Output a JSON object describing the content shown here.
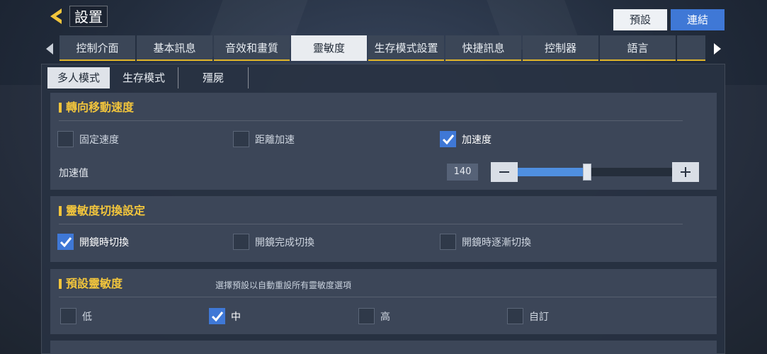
{
  "header": {
    "title": "設置",
    "preset_label": "預設",
    "link_label": "連結"
  },
  "tabs": [
    {
      "label": "控制介面",
      "active": false
    },
    {
      "label": "基本訊息",
      "active": false
    },
    {
      "label": "音效和畫質",
      "active": false
    },
    {
      "label": "靈敏度",
      "active": true
    },
    {
      "label": "生存模式設置",
      "active": false
    },
    {
      "label": "快捷訊息",
      "active": false
    },
    {
      "label": "控制器",
      "active": false
    },
    {
      "label": "語言",
      "active": false
    }
  ],
  "subtabs": [
    {
      "label": "多人模式",
      "active": true
    },
    {
      "label": "生存模式",
      "active": false
    },
    {
      "label": "殭屍",
      "active": false
    }
  ],
  "turn_speed": {
    "title": "轉向移動速度",
    "options": [
      {
        "label": "固定速度",
        "checked": false
      },
      {
        "label": "距離加速",
        "checked": false
      },
      {
        "label": "加速度",
        "checked": true
      }
    ],
    "accel_label": "加速值",
    "accel_value": "140",
    "accel_fraction": 0.45
  },
  "switch_settings": {
    "title": "靈敏度切換設定",
    "options": [
      {
        "label": "開鏡時切換",
        "checked": true
      },
      {
        "label": "開鏡完成切換",
        "checked": false
      },
      {
        "label": "開鏡時逐漸切換",
        "checked": false
      }
    ]
  },
  "preset_sensitivity": {
    "title": "預設靈敏度",
    "description": "選擇預設以自動重設所有靈敏度選項",
    "options": [
      {
        "label": "低",
        "checked": false
      },
      {
        "label": "中",
        "checked": true
      },
      {
        "label": "高",
        "checked": false
      },
      {
        "label": "自訂",
        "checked": false
      }
    ]
  },
  "colors": {
    "accent_blue": "#3f78d6",
    "accent_yellow": "#f2c53c",
    "tab_active_bg": "#e9ecf0"
  }
}
